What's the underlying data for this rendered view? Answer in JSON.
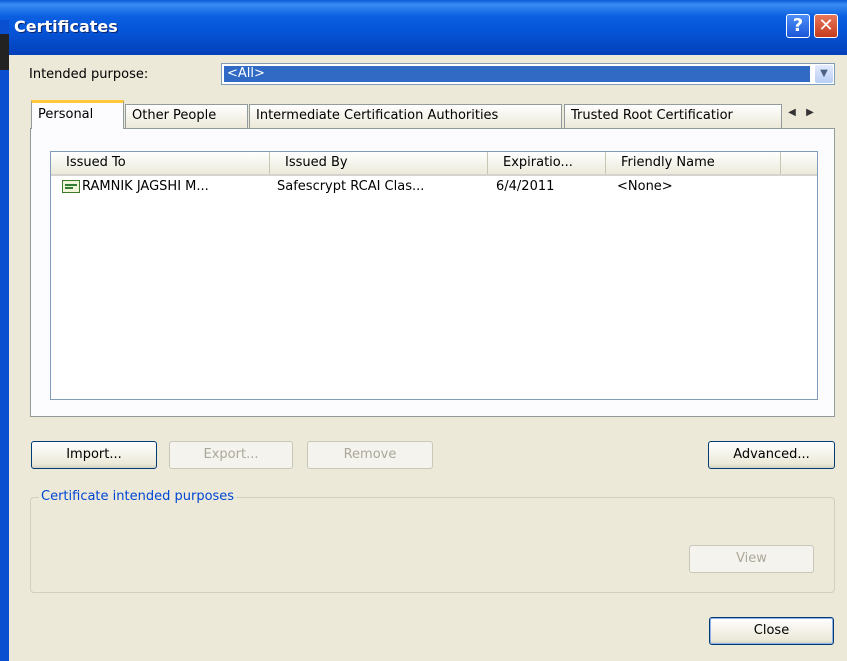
{
  "window": {
    "title": "Certificates",
    "help_glyph": "?",
    "close_glyph": "✕"
  },
  "purpose": {
    "label": "Intended purpose:",
    "value": "<All>"
  },
  "tabs": [
    {
      "label": "Personal",
      "active": true
    },
    {
      "label": "Other People",
      "active": false
    },
    {
      "label": "Intermediate Certification Authorities",
      "active": false
    },
    {
      "label": "Trusted Root Certificatior",
      "active": false
    }
  ],
  "table": {
    "columns": [
      "Issued To",
      "Issued By",
      "Expiratio...",
      "Friendly Name"
    ],
    "rows": [
      {
        "issued_to": "RAMNIK JAGSHI M...",
        "issued_by": "Safescrypt RCAI Clas...",
        "expiration": "6/4/2011",
        "friendly_name": "<None>"
      }
    ]
  },
  "buttons": {
    "import": "Import...",
    "export": "Export...",
    "remove": "Remove",
    "advanced": "Advanced...",
    "view": "View",
    "close": "Close"
  },
  "group": {
    "label": "Certificate intended purposes"
  },
  "colors": {
    "titlebar": "#0553d6",
    "selection": "#316ac5",
    "group_label": "#0046d5",
    "tab_highlight": "#ffc83c"
  }
}
